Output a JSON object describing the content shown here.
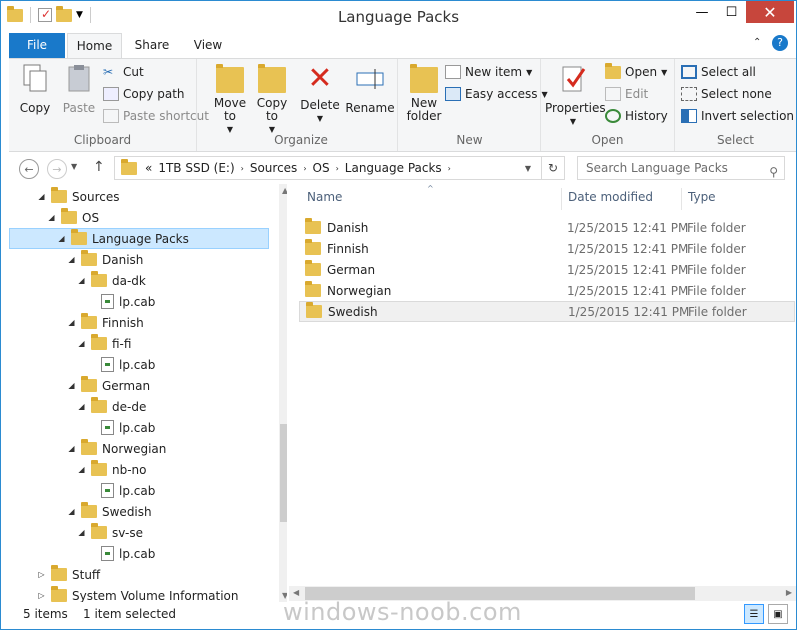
{
  "window": {
    "title": "Language Packs"
  },
  "tabs": [
    {
      "label": "File"
    },
    {
      "label": "Home"
    },
    {
      "label": "Share"
    },
    {
      "label": "View"
    }
  ],
  "ribbon": {
    "clipboard": {
      "label": "Clipboard",
      "copy": "Copy",
      "paste": "Paste",
      "cut": "Cut",
      "copy_path": "Copy path",
      "paste_shortcut": "Paste shortcut"
    },
    "organize": {
      "label": "Organize",
      "move_to": "Move to",
      "copy_to": "Copy to",
      "delete": "Delete",
      "rename": "Rename"
    },
    "new": {
      "label": "New",
      "new_folder": "New folder",
      "new_item": "New item",
      "easy_access": "Easy access"
    },
    "open": {
      "label": "Open",
      "properties": "Properties",
      "open": "Open",
      "edit": "Edit",
      "history": "History"
    },
    "select": {
      "label": "Select",
      "select_all": "Select all",
      "select_none": "Select none",
      "invert": "Invert selection"
    }
  },
  "address": {
    "prefix": "«",
    "crumbs": [
      "1TB SSD (E:)",
      "Sources",
      "OS",
      "Language Packs"
    ]
  },
  "search": {
    "placeholder": "Search Language Packs"
  },
  "tree": [
    {
      "label": "Sources",
      "level": 0,
      "expanded": true,
      "type": "folder"
    },
    {
      "label": "OS",
      "level": 1,
      "expanded": true,
      "type": "folder"
    },
    {
      "label": "Language Packs",
      "level": 2,
      "expanded": true,
      "type": "folder",
      "selected": true
    },
    {
      "label": "Danish",
      "level": 3,
      "expanded": true,
      "type": "folder"
    },
    {
      "label": "da-dk",
      "level": 4,
      "expanded": true,
      "type": "folder"
    },
    {
      "label": "lp.cab",
      "level": 5,
      "type": "file"
    },
    {
      "label": "Finnish",
      "level": 3,
      "expanded": true,
      "type": "folder"
    },
    {
      "label": "fi-fi",
      "level": 4,
      "expanded": true,
      "type": "folder"
    },
    {
      "label": "lp.cab",
      "level": 5,
      "type": "file"
    },
    {
      "label": "German",
      "level": 3,
      "expanded": true,
      "type": "folder"
    },
    {
      "label": "de-de",
      "level": 4,
      "expanded": true,
      "type": "folder"
    },
    {
      "label": "lp.cab",
      "level": 5,
      "type": "file"
    },
    {
      "label": "Norwegian",
      "level": 3,
      "expanded": true,
      "type": "folder"
    },
    {
      "label": "nb-no",
      "level": 4,
      "expanded": true,
      "type": "folder"
    },
    {
      "label": "lp.cab",
      "level": 5,
      "type": "file"
    },
    {
      "label": "Swedish",
      "level": 3,
      "expanded": true,
      "type": "folder"
    },
    {
      "label": "sv-se",
      "level": 4,
      "expanded": true,
      "type": "folder"
    },
    {
      "label": "lp.cab",
      "level": 5,
      "type": "file"
    },
    {
      "label": "Stuff",
      "level": 0,
      "expanded": false,
      "type": "folder"
    },
    {
      "label": "System Volume Information",
      "level": 0,
      "expanded": false,
      "type": "folder"
    }
  ],
  "columns": {
    "name": "Name",
    "date": "Date modified",
    "type": "Type"
  },
  "files": [
    {
      "name": "Danish",
      "date": "1/25/2015 12:41 PM",
      "type": "File folder"
    },
    {
      "name": "Finnish",
      "date": "1/25/2015 12:41 PM",
      "type": "File folder"
    },
    {
      "name": "German",
      "date": "1/25/2015 12:41 PM",
      "type": "File folder"
    },
    {
      "name": "Norwegian",
      "date": "1/25/2015 12:41 PM",
      "type": "File folder"
    },
    {
      "name": "Swedish",
      "date": "1/25/2015 12:41 PM",
      "type": "File folder",
      "selected": true
    }
  ],
  "status": {
    "count": "5 items",
    "selected": "1 item selected"
  },
  "watermark": "windows-noob.com",
  "colors": {
    "accent": "#1979ca",
    "close": "#c7463c",
    "folder": "#e8c253",
    "selection": "#cce8ff"
  }
}
